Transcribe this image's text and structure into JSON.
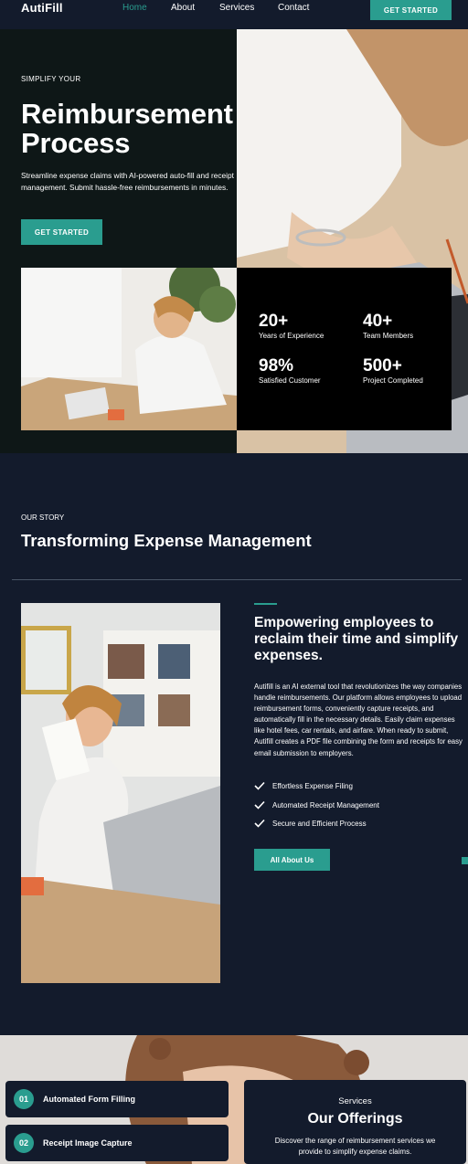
{
  "nav": {
    "logo": "AutiFill",
    "links": [
      "Home",
      "About",
      "Services",
      "Contact"
    ],
    "active_link": "Home",
    "cta": "GET STARTED"
  },
  "hero": {
    "kicker": "SIMPLIFY YOUR",
    "title_line1": "Reimbursement",
    "title_line2": "Process",
    "description": "Streamline expense claims with AI-powered auto-fill and receipt management. Submit hassle-free reimbursements in minutes.",
    "cta": "GET STARTED"
  },
  "stats": [
    {
      "value": "20+",
      "label": "Years of Experience"
    },
    {
      "value": "40+",
      "label": "Team Members"
    },
    {
      "value": "98%",
      "label": "Satisfied Customer"
    },
    {
      "value": "500+",
      "label": "Project Completed"
    }
  ],
  "story": {
    "kicker": "OUR STORY",
    "title": "Transforming Expense Management",
    "subtitle": "Empowering employees to reclaim their time and simplify expenses.",
    "body": "Autifill is an AI external tool that revolutionizes the way companies handle reimbursements. Our platform allows employees to upload reimbursement forms, conveniently capture receipts, and automatically fill in the necessary details. Easily claim expenses like hotel fees, car rentals, and airfare. When ready to submit, Autifill creates a PDF file combining the form and receipts for easy email submission to employers.",
    "features": [
      "Effortless Expense Filing",
      "Automated Receipt Management",
      "Secure and Efficient Process"
    ],
    "button": "All About Us"
  },
  "services": {
    "items": [
      {
        "num": "01",
        "label": "Automated Form Filling"
      },
      {
        "num": "02",
        "label": "Receipt Image Capture"
      }
    ],
    "kicker": "Services",
    "title": "Our Offerings",
    "description": "Discover the range of reimbursement services we provide to simplify expense claims."
  },
  "colors": {
    "accent": "#2a9d8f",
    "background": "#131b2c",
    "hero_panel": "#0e1717",
    "stats_panel": "#000000"
  },
  "icons": [
    "check-icon"
  ]
}
